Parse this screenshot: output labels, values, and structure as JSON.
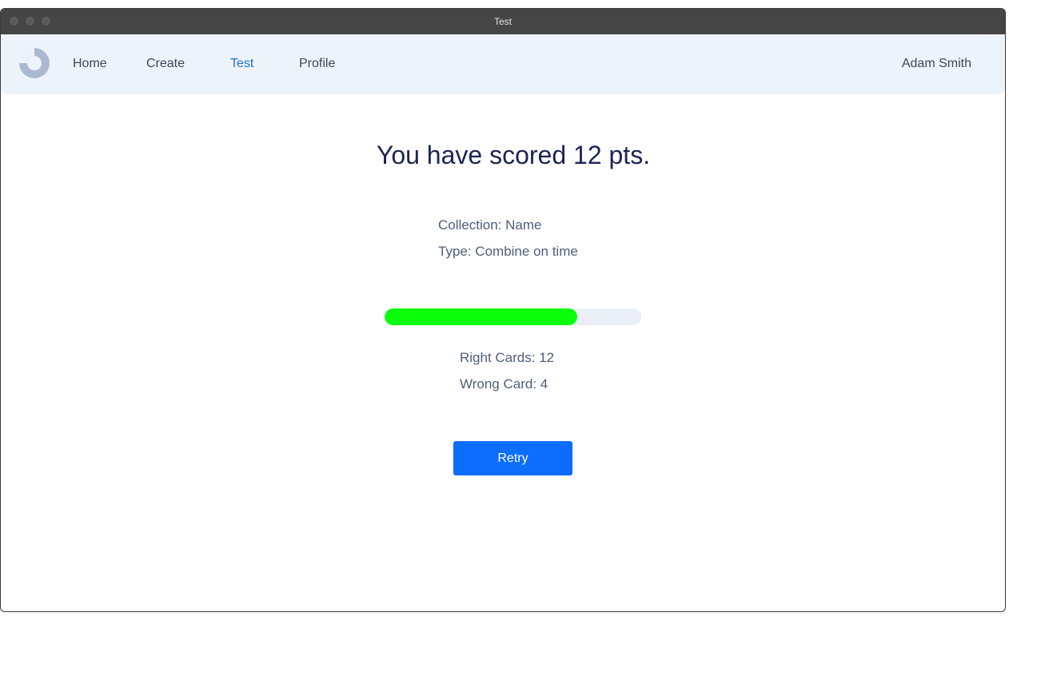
{
  "window": {
    "title": "Test"
  },
  "nav": {
    "items": [
      {
        "label": "Home",
        "active": false
      },
      {
        "label": "Create",
        "active": false
      },
      {
        "label": "Test",
        "active": true
      },
      {
        "label": "Profile",
        "active": false
      }
    ],
    "user": "Adam Smith",
    "logo_icon": "logo-icon"
  },
  "result": {
    "title": "You have scored 12 pts.",
    "collection": "Collection: Name",
    "type": "Type: Combine on time",
    "progress_fraction": 0.75,
    "right_cards": "Right Cards: 12",
    "wrong_cards": "Wrong Card: 4",
    "retry_label": "Retry"
  },
  "colors": {
    "accent": "#0d6efd",
    "active_nav": "#1a73d4",
    "progress": "#0aff0a",
    "heading": "#1c2454",
    "navbar_bg": "#edf3fb"
  }
}
